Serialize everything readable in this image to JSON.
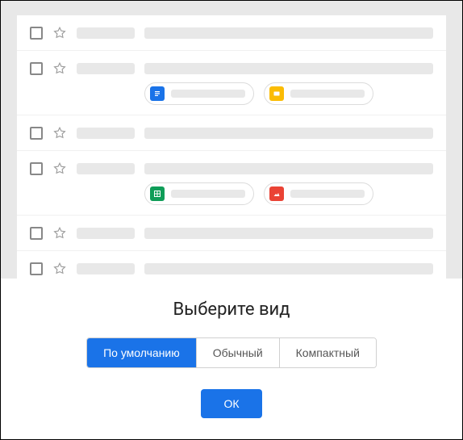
{
  "title": "Выберите вид",
  "density_options": {
    "default": "По умолчанию",
    "comfortable": "Обычный",
    "compact": "Компактный"
  },
  "selected_option": "default",
  "ok_label": "ОК",
  "rows": [
    {
      "attachments": []
    },
    {
      "attachments": [
        {
          "kind": "doc",
          "color": "blue"
        },
        {
          "kind": "slides",
          "color": "yellow"
        }
      ]
    },
    {
      "attachments": []
    },
    {
      "attachments": [
        {
          "kind": "sheets",
          "color": "green"
        },
        {
          "kind": "image",
          "color": "red"
        }
      ]
    },
    {
      "attachments": []
    },
    {
      "attachments": []
    }
  ]
}
